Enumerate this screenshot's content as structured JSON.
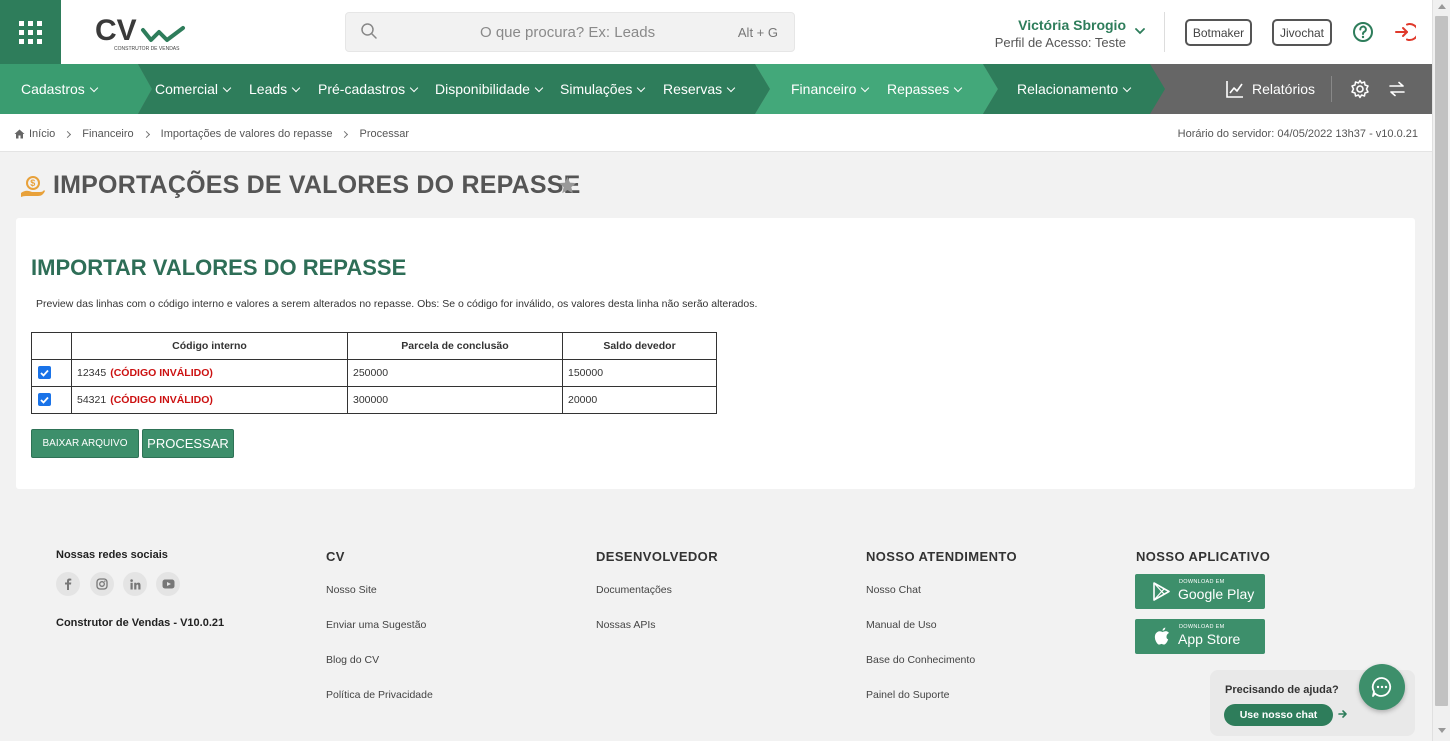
{
  "header": {
    "logo_text": "CV",
    "logo_sub": "CONSTRUTOR DE VENDAS",
    "search_placeholder": "O que procura? Ex: Leads",
    "search_shortcut": "Alt + G",
    "user_name": "Victória Sbrogio",
    "user_profile": "Perfil de Acesso: Teste",
    "botmaker": "Botmaker",
    "jivochat": "Jivochat"
  },
  "nav": {
    "cadastros": "Cadastros",
    "comercial": "Comercial",
    "leads": "Leads",
    "pre_cadastros": "Pré-cadastros",
    "disponibilidade": "Disponibilidade",
    "simulacoes": "Simulações",
    "reservas": "Reservas",
    "financeiro": "Financeiro",
    "repasses": "Repasses",
    "relacionamento": "Relacionamento",
    "relatorios": "Relatórios",
    "colors": {
      "dark": "#2e7d5b",
      "mid": "#3a9c70",
      "light": "#43a87a",
      "gray": "#666666"
    }
  },
  "breadcrumb": {
    "items": [
      "Início",
      "Financeiro",
      "Importações de valores do repasse",
      "Processar"
    ],
    "server_time": "Horário do servidor: 04/05/2022 13h37 - v10.0.21"
  },
  "page": {
    "title": "IMPORTAÇÕES DE VALORES DO REPASSE"
  },
  "card": {
    "heading": "IMPORTAR VALORES DO REPASSE",
    "description": "Preview das linhas com o código interno e valores a serem alterados no repasse. Obs: Se o código for inválido, os valores desta linha não serão alterados.",
    "table": {
      "headers": [
        "Código interno",
        "Parcela de conclusão",
        "Saldo devedor"
      ],
      "rows": [
        {
          "code": "12345",
          "status": "(CÓDIGO INVÁLIDO)",
          "parcela": "250000",
          "saldo": "150000",
          "checked": true
        },
        {
          "code": "54321",
          "status": "(CÓDIGO INVÁLIDO)",
          "parcela": "300000",
          "saldo": "20000",
          "checked": true
        }
      ]
    },
    "btn_download": "BAIXAR ARQUIVO",
    "btn_process": "PROCESSAR"
  },
  "footer": {
    "social_title": "Nossas redes sociais",
    "version": "Construtor de Vendas - V10.0.21",
    "col_cv": {
      "title": "CV",
      "links": [
        "Nosso Site",
        "Enviar uma Sugestão",
        "Blog do CV",
        "Política de Privacidade"
      ]
    },
    "col_dev": {
      "title": "DESENVOLVEDOR",
      "links": [
        "Documentações",
        "Nossas APIs"
      ]
    },
    "col_support": {
      "title": "NOSSO ATENDIMENTO",
      "links": [
        "Nosso Chat",
        "Manual de Uso",
        "Base do Conhecimento",
        "Painel do Suporte"
      ]
    },
    "col_app": {
      "title": "NOSSO APLICATIVO",
      "google_small": "DOWNLOAD EM",
      "google_big": "Google Play",
      "apple_small": "DOWNLOAD EM",
      "apple_big": "App Store"
    }
  },
  "help": {
    "title": "Precisando de ajuda?",
    "button": "Use nosso chat"
  }
}
